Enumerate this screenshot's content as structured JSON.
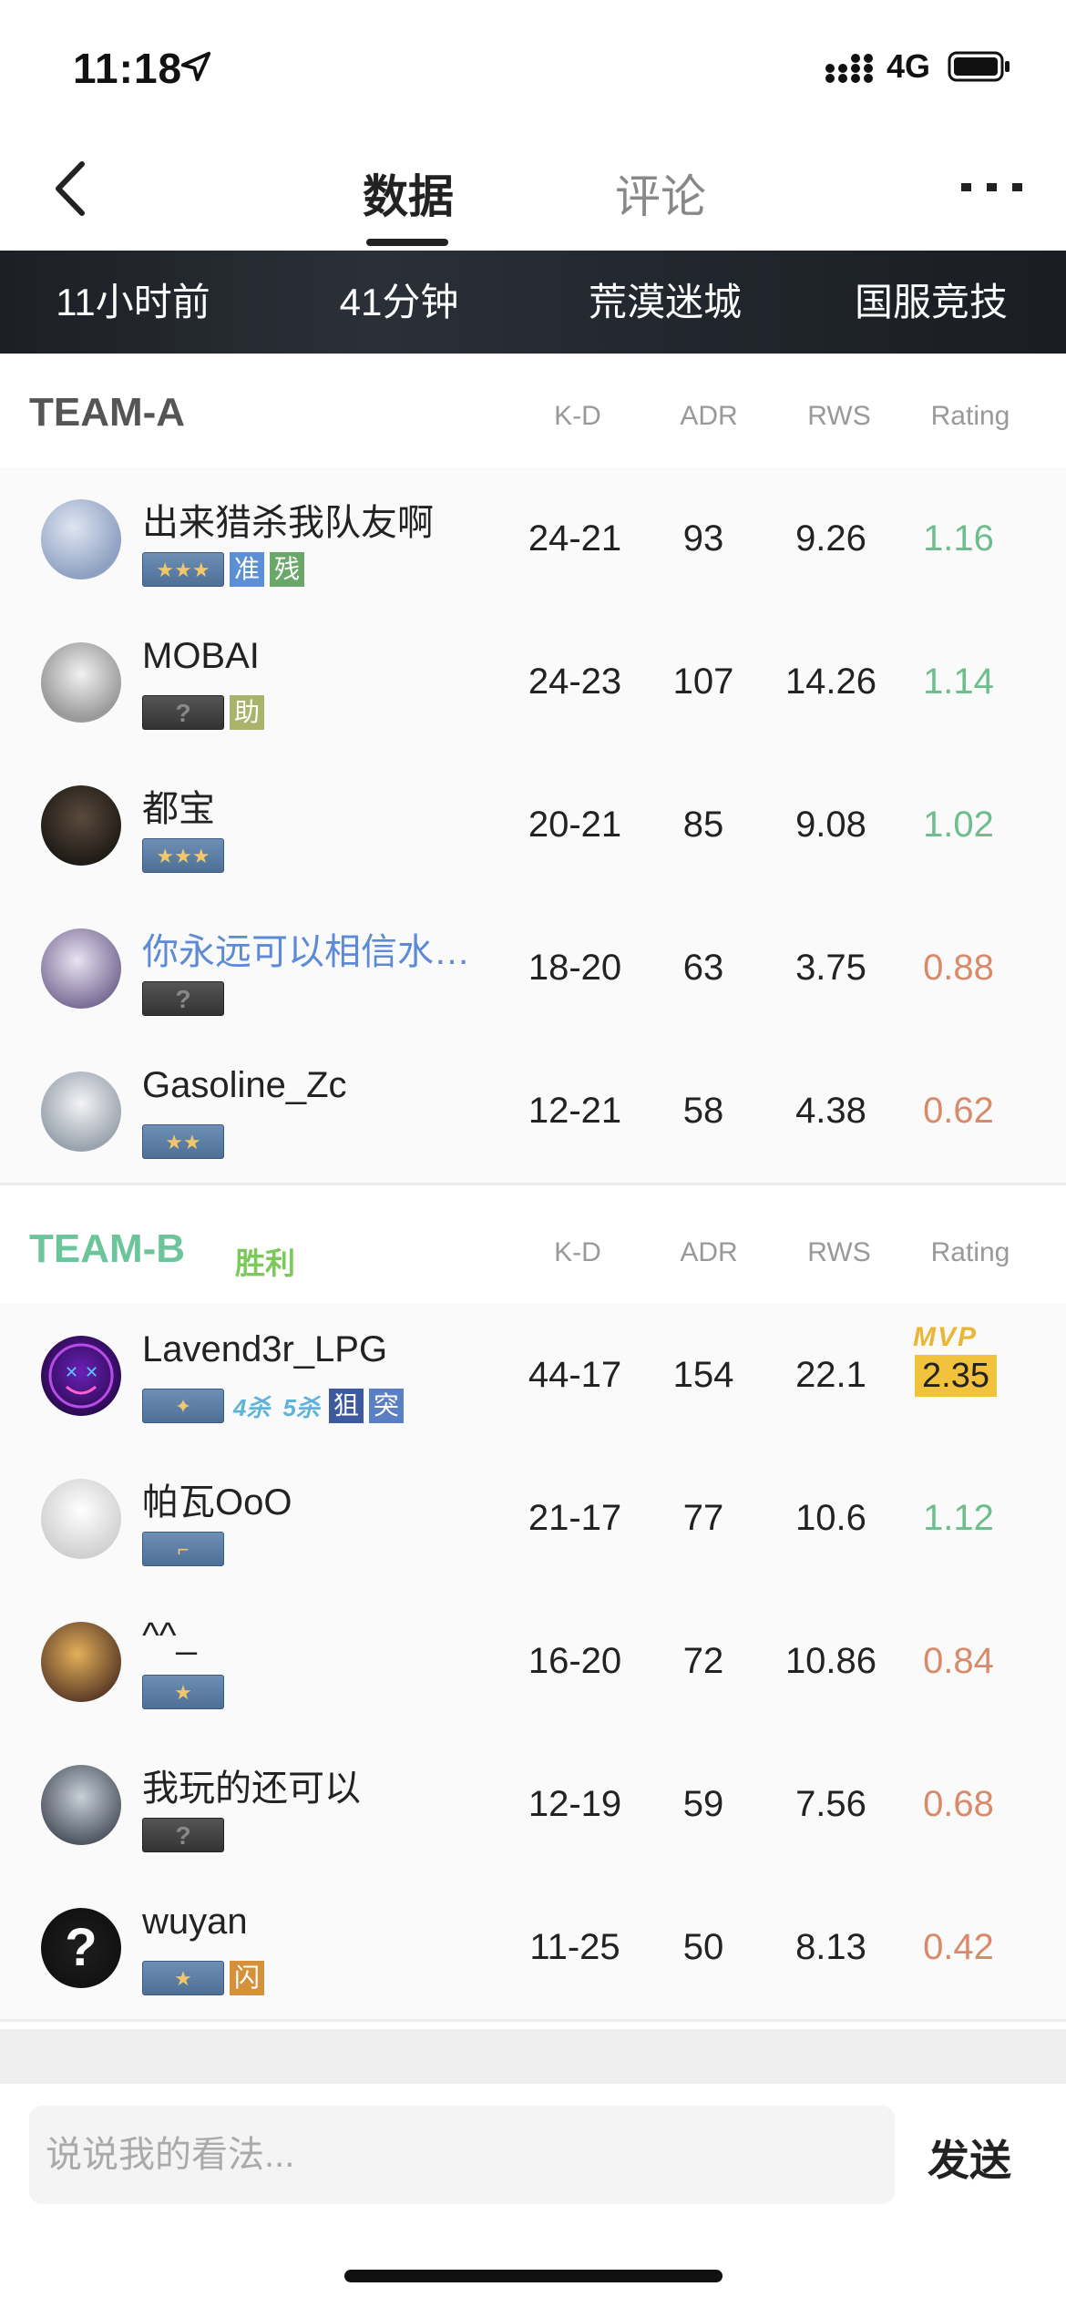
{
  "status_bar": {
    "time": "11:18",
    "network": "4G"
  },
  "nav": {
    "tab_active": "数据",
    "tab_inactive": "评论"
  },
  "info_band": [
    "11小时前",
    "41分钟",
    "荒漠迷城",
    "国服竞技"
  ],
  "columns": {
    "kd": "K-D",
    "adr": "ADR",
    "rws": "RWS",
    "rating": "Rating"
  },
  "team_a": {
    "name": "TEAM-A",
    "players": [
      {
        "name": "出来猎杀我队友啊",
        "kd": "24-21",
        "adr": "93",
        "rws": "9.26",
        "rating": "1.16",
        "rating_status": "good",
        "rank": "★★★",
        "tags": [
          {
            "text": "准",
            "color": "#5b8fd6"
          },
          {
            "text": "残",
            "color": "#6aa86a"
          }
        ]
      },
      {
        "name": "MOBAI",
        "kd": "24-23",
        "adr": "107",
        "rws": "14.26",
        "rating": "1.14",
        "rating_status": "good",
        "rank": "?",
        "tags": [
          {
            "text": "助",
            "color": "#a9b36a"
          }
        ]
      },
      {
        "name": "都宝",
        "kd": "20-21",
        "adr": "85",
        "rws": "9.08",
        "rating": "1.02",
        "rating_status": "good",
        "rank": "★★★",
        "tags": []
      },
      {
        "name": "你永远可以相信水…",
        "kd": "18-20",
        "adr": "63",
        "rws": "3.75",
        "rating": "0.88",
        "rating_status": "bad",
        "rank": "?",
        "tags": []
      },
      {
        "name": "Gasoline_Zc",
        "kd": "12-21",
        "adr": "58",
        "rws": "4.38",
        "rating": "0.62",
        "rating_status": "bad",
        "rank": "★★",
        "tags": []
      }
    ]
  },
  "team_b": {
    "name": "TEAM-B",
    "result": "胜利",
    "players": [
      {
        "name": "Lavend3r_LPG",
        "kd": "44-17",
        "adr": "154",
        "rws": "22.1",
        "rating": "2.35",
        "rating_status": "mvp",
        "mvp_label": "MVP",
        "rank": "✦",
        "multikills": [
          "4杀",
          "5杀"
        ],
        "tags": [
          {
            "text": "狙",
            "color": "#3e5a9e"
          },
          {
            "text": "突",
            "color": "#5b7fc4"
          }
        ]
      },
      {
        "name": "帕瓦OoO",
        "kd": "21-17",
        "adr": "77",
        "rws": "10.6",
        "rating": "1.12",
        "rating_status": "good",
        "rank": "⌐",
        "tags": []
      },
      {
        "name": "^^_",
        "kd": "16-20",
        "adr": "72",
        "rws": "10.86",
        "rating": "0.84",
        "rating_status": "bad",
        "rank": "★",
        "tags": []
      },
      {
        "name": "我玩的还可以",
        "kd": "12-19",
        "adr": "59",
        "rws": "7.56",
        "rating": "0.68",
        "rating_status": "bad",
        "rank": "?",
        "tags": []
      },
      {
        "name": "wuyan",
        "kd": "11-25",
        "adr": "50",
        "rws": "8.13",
        "rating": "0.42",
        "rating_status": "bad",
        "rank": "★",
        "tags": [
          {
            "text": "闪",
            "color": "#d4913a"
          }
        ]
      }
    ]
  },
  "comment": {
    "placeholder": "说说我的看法...",
    "send_label": "发送"
  }
}
